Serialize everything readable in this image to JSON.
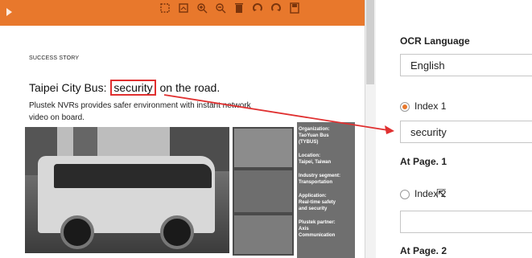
{
  "document": {
    "section_label": "SUCCESS STORY",
    "title_before": "Taipei City Bus:",
    "title_highlight": "security",
    "title_after": "on the road.",
    "subtitle": "Plustek NVRs provides safer environment with instant network video on board.",
    "info_boxes": [
      "Organization:\nTaoYuan Bus\n(TYBUS)",
      "Location:\nTaipei, Taiwan",
      "Industry segment:\nTransportation",
      "Application:\nReal-time safety\nand security",
      "Plustek partner:\nAxis\nCommunication"
    ]
  },
  "toolbar": {
    "icons": [
      "select-area-icon",
      "crop-icon",
      "zoom-in-icon",
      "zoom-out-icon",
      "delete-icon",
      "rotate-left-icon",
      "rotate-right-icon",
      "save-icon"
    ]
  },
  "ocr_panel": {
    "language_label": "OCR Language",
    "language_value": "English",
    "index1_label": "Index 1",
    "index1_value": "security",
    "page1_label": "At Page. 1",
    "index2_label": "Index 2",
    "index2_value": "",
    "page2_label": "At Page. 2"
  },
  "colors": {
    "toolbar": "#e8782c",
    "highlight": "#e03030",
    "radio_selected": "#e8782c"
  }
}
